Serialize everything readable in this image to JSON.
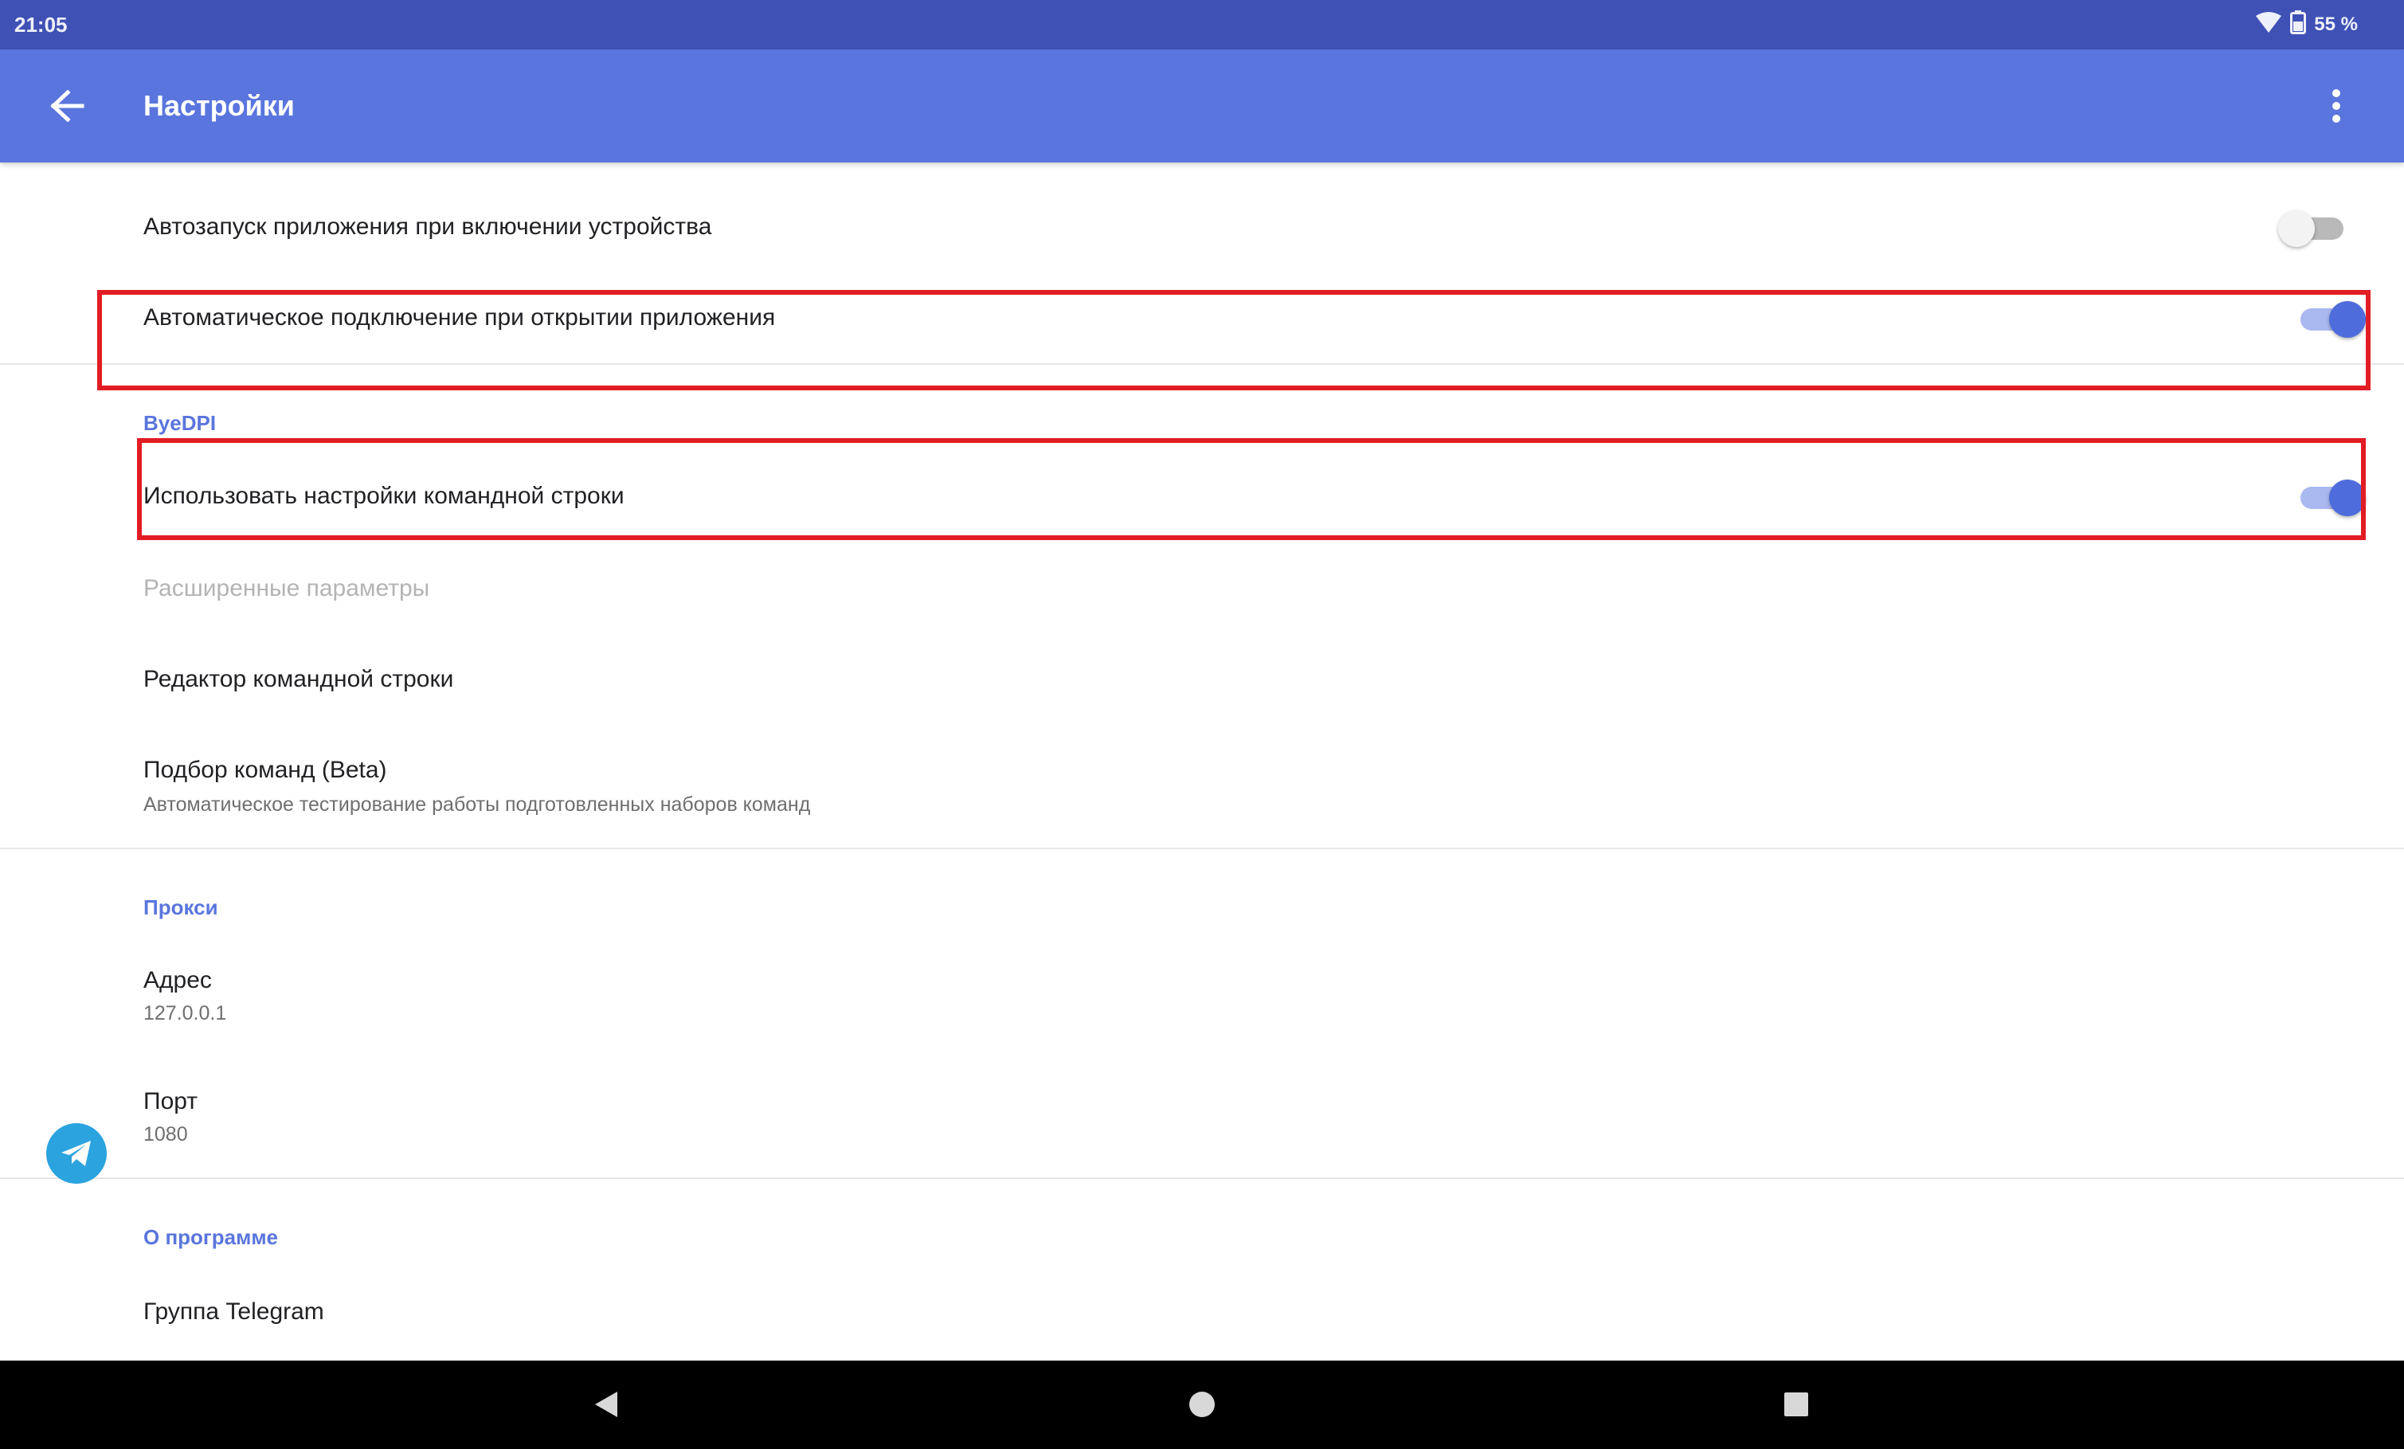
{
  "status_bar": {
    "time": "21:05",
    "battery": "55 %",
    "icons": [
      "wifi-icon",
      "battery-icon"
    ]
  },
  "app_bar": {
    "title": "Настройки",
    "back_icon": "arrow-back-icon",
    "menu_icon": "more-vert-icon"
  },
  "settings": {
    "autostart": {
      "title": "Автозапуск приложения при включении устройства",
      "enabled": false
    },
    "auto_connect": {
      "title": "Автоматическое подключение при открытии приложения",
      "enabled": true
    },
    "byedpi": {
      "header": "ByeDPI",
      "use_cmd": {
        "title": "Использовать настройки командной строки",
        "enabled": true
      },
      "advanced": {
        "title": "Расширенные параметры",
        "disabled": true
      },
      "cmd_editor": {
        "title": "Редактор командной строки"
      },
      "cmd_picker": {
        "title": "Подбор команд (Beta)",
        "summary": "Автоматическое тестирование работы подготовленных наборов команд"
      }
    },
    "proxy": {
      "header": "Прокси",
      "address": {
        "title": "Адрес",
        "value": "127.0.0.1"
      },
      "port": {
        "title": "Порт",
        "value": "1080"
      }
    },
    "about": {
      "header": "О программе",
      "telegram": {
        "title": "Группа Telegram",
        "icon": "telegram-icon"
      }
    }
  },
  "colors": {
    "status_bar": "#3f51b5",
    "app_bar": "#5a75dd",
    "accent": "#4e6cdc",
    "highlight": "#e21c24"
  },
  "nav_bar": {
    "icons": [
      "nav-back-icon",
      "nav-home-icon",
      "nav-recents-icon"
    ]
  }
}
